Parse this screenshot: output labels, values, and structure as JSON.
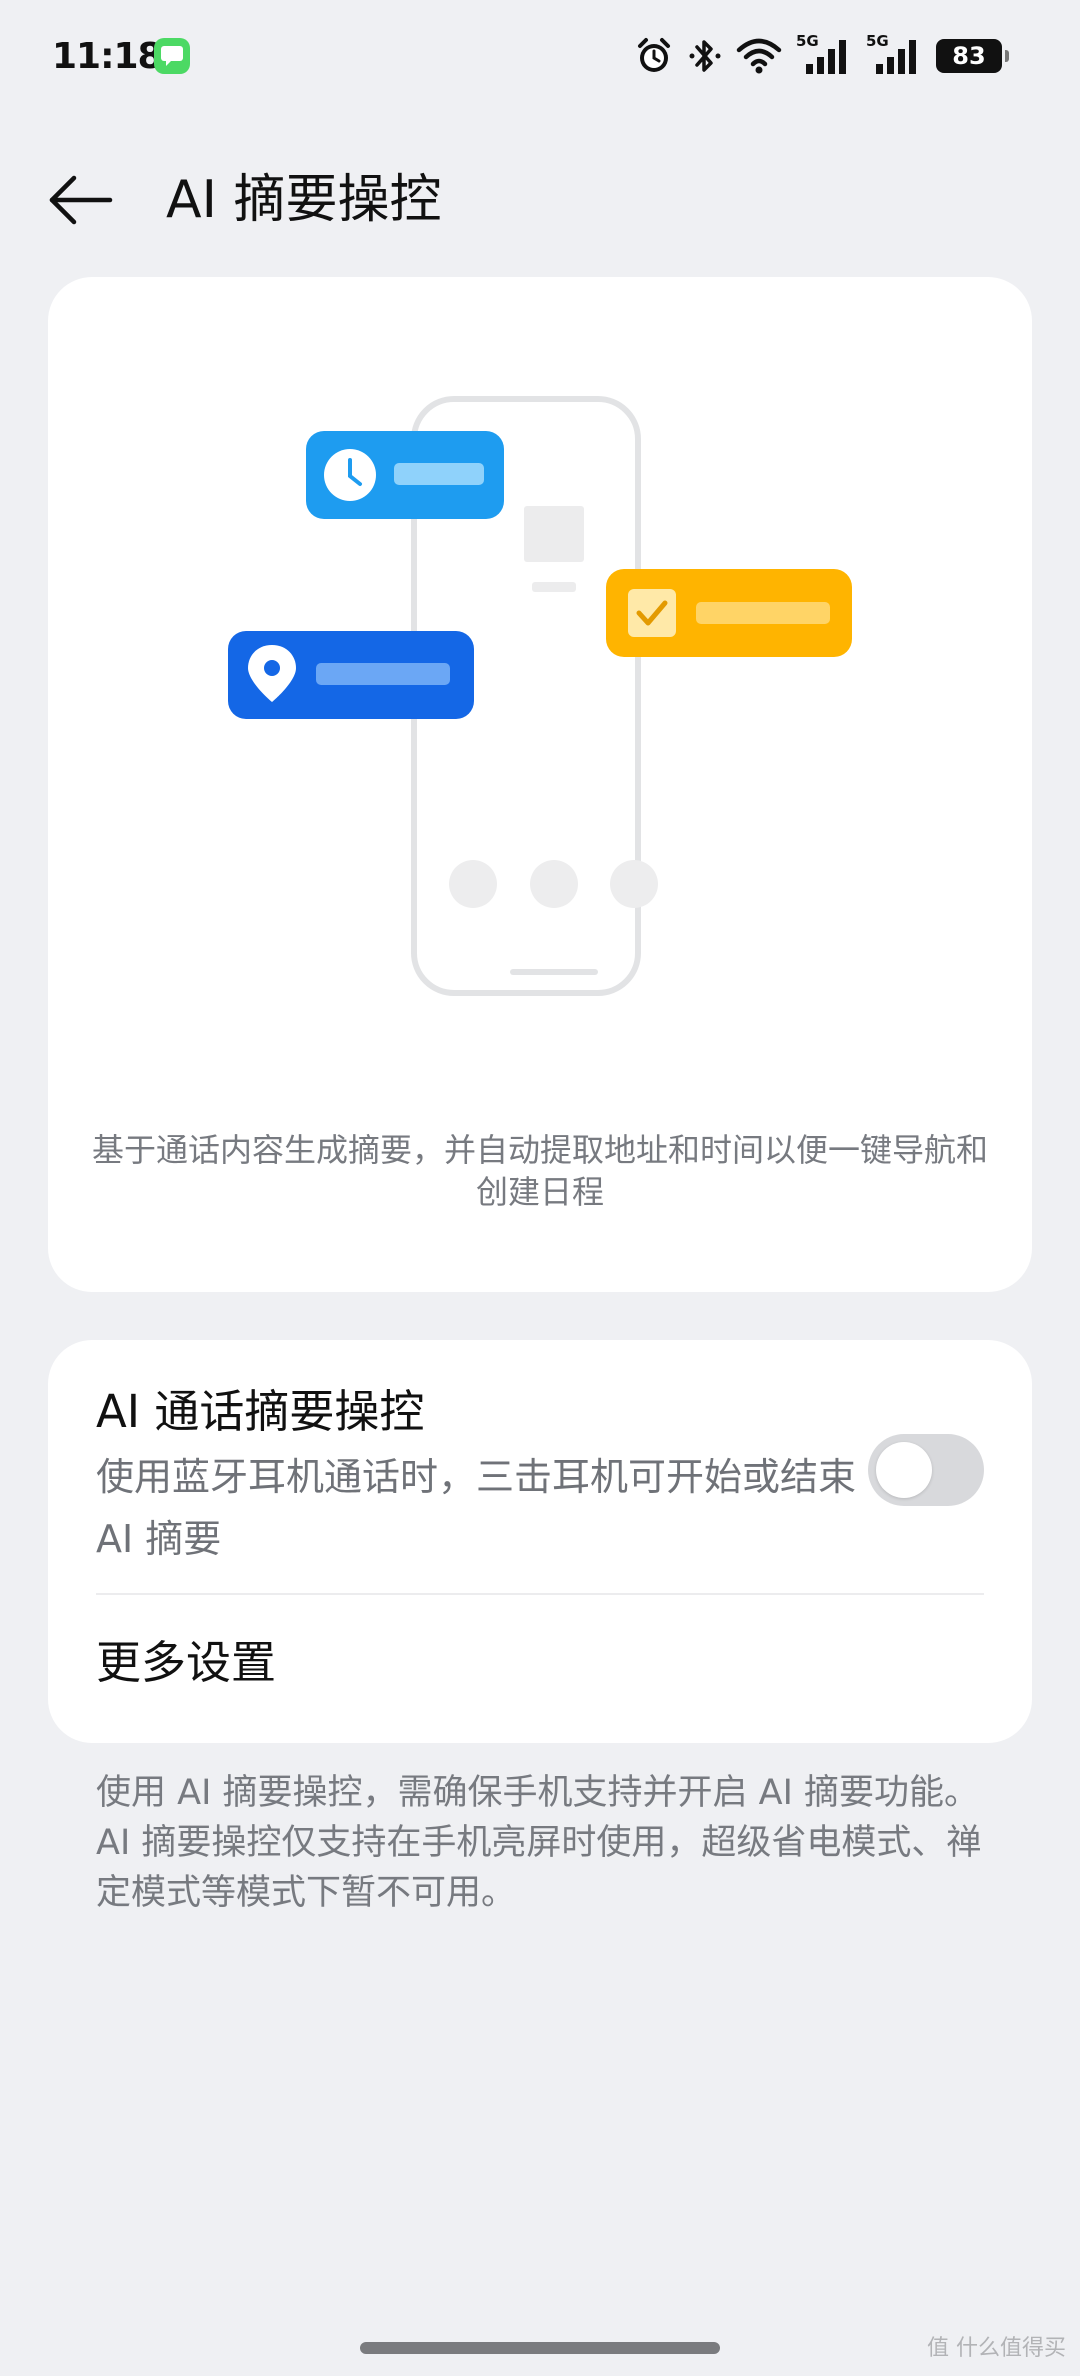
{
  "status_bar": {
    "time": "11:18",
    "network_5g_1": "5G",
    "network_5g_2": "5G",
    "battery": "83"
  },
  "header": {
    "title": "AI 摘要操控"
  },
  "illustration": {
    "description": "基于通话内容生成摘要，并自动提取地址和时间以便一键导航和创建日程"
  },
  "settings": {
    "call_summary": {
      "title": "AI 通话摘要操控",
      "subtitle": "使用蓝牙耳机通话时，三击耳机可开始或结束 AI 摘要",
      "enabled": false
    },
    "more_settings": "更多设置"
  },
  "footnote": "使用 AI 摘要操控，需确保手机支持并开启 AI 摘要功能。AI 摘要操控仅支持在手机亮屏时使用，超级省电模式、禅定模式等模式下暂不可用。",
  "watermark": "值 什么值得买",
  "colors": {
    "background": "#eff0f3",
    "card": "#ffffff",
    "blue_light": "#1e9cf0",
    "blue_dark": "#1467e6",
    "yellow": "#ffb400",
    "toggle_off": "#d8d9dc"
  }
}
